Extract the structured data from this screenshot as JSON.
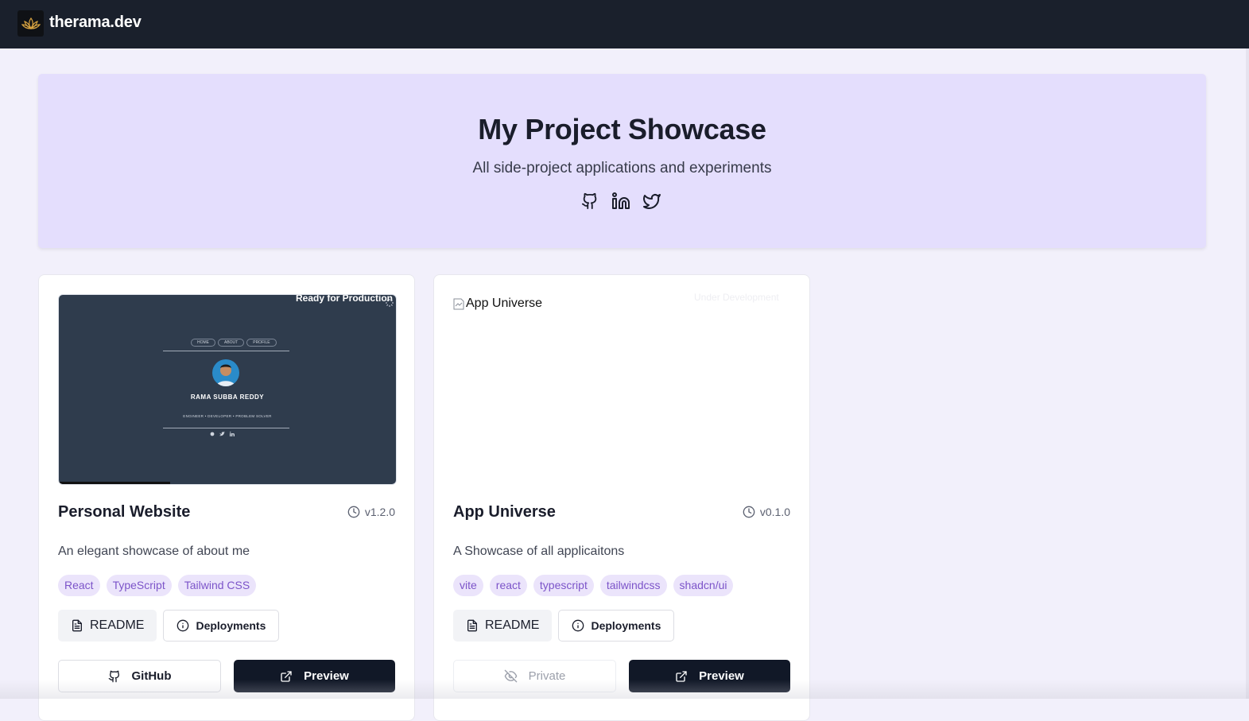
{
  "header": {
    "brand": "therama.dev",
    "logo_icon": "lotus-icon"
  },
  "hero": {
    "title": "My Project Showcase",
    "subtitle": "All side-project applications and experiments",
    "social_icons": [
      "github-icon",
      "linkedin-icon",
      "twitter-icon"
    ]
  },
  "projects": [
    {
      "title": "Personal Website",
      "version": "v1.2.0",
      "status": "Ready for Production",
      "description": "An elegant showcase of about me",
      "tags": [
        "React",
        "TypeScript",
        "Tailwind CSS"
      ],
      "readme_label": "README",
      "deployments_label": "Deployments",
      "source_label": "GitHub",
      "preview_label": "Preview",
      "thumbnail": {
        "nav": [
          "HOME",
          "ABOUT",
          "PROFILE"
        ],
        "name": "RAMA SUBBA REDDY",
        "tagline": "ENGINEER • DEVELOPER • PROBLEM SOLVER"
      }
    },
    {
      "title": "App Universe",
      "version": "v0.1.0",
      "status": "Under Development",
      "image_alt": "App Universe",
      "description": "A Showcase of all applicaitons",
      "tags": [
        "vite",
        "react",
        "typescript",
        "tailwindcss",
        "shadcn/ui"
      ],
      "readme_label": "README",
      "deployments_label": "Deployments",
      "source_label": "Private",
      "preview_label": "Preview"
    }
  ],
  "colors": {
    "topbar": "#1a202c",
    "hero_bg": "#e4defd",
    "page_bg": "#f2f0fb",
    "tag_bg": "#ebe4fb",
    "tag_text": "#7c54c9",
    "primary_button": "#111827"
  }
}
